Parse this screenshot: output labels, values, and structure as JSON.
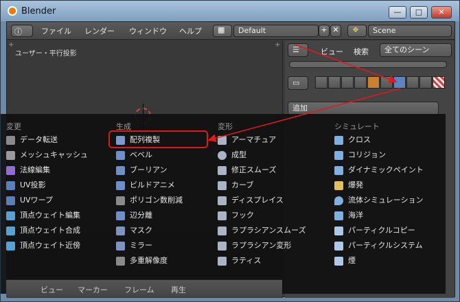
{
  "window": {
    "title": "Blender",
    "min": "—",
    "max": "□",
    "close": "✕"
  },
  "header": {
    "menus": [
      "ファイル",
      "レンダー",
      "ウィンドウ",
      "ヘルプ"
    ],
    "layout_field": "Default",
    "scene_field": "Scene",
    "add_symbol": "+",
    "remove_symbol": "✕"
  },
  "viewport": {
    "label": "ユーザー・平行投影"
  },
  "right_panel": {
    "view_label": "ビュー",
    "search_label": "検索",
    "scenes_dropdown": "全てのシーン",
    "add_dropdown": "追加"
  },
  "bottom": {
    "view": "ビュー",
    "marker": "マーカー",
    "frame": "フレーム",
    "play": "再生"
  },
  "popup": {
    "columns": [
      {
        "title": "変更",
        "items": [
          "データ転送",
          "メッシュキャッシュ",
          "法線編集",
          "UV投影",
          "UVワープ",
          "頂点ウェイト編集",
          "頂点ウェイト合成",
          "頂点ウェイト近傍"
        ]
      },
      {
        "title": "生成",
        "items": [
          "配列複製",
          "ベベル",
          "ブーリアン",
          "ビルドアニメ",
          "ポリゴン数削減",
          "辺分離",
          "マスク",
          "ミラー",
          "多重解像度"
        ]
      },
      {
        "title": "変形",
        "items": [
          "アーマチュア",
          "成型",
          "修正スムーズ",
          "カーブ",
          "ディスプレイス",
          "フック",
          "ラプラシアンスムーズ",
          "ラプラシアン変形",
          "ラティス"
        ]
      },
      {
        "title": "シミュレート",
        "items": [
          "クロス",
          "コリジョン",
          "ダイナミックペイント",
          "爆発",
          "流体シミュレーション",
          "海洋",
          "パーティクルコピー",
          "パーティクルシステム",
          "煙"
        ]
      }
    ]
  },
  "colors": {
    "highlight": "#e0191a",
    "arrow": "#e0191a"
  }
}
